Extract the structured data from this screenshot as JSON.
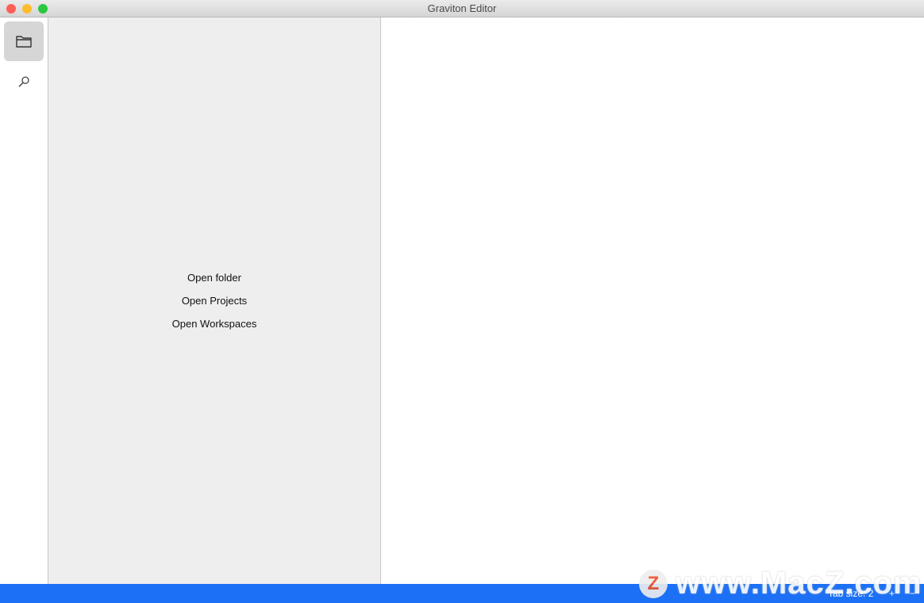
{
  "window": {
    "title": "Graviton Editor"
  },
  "activity_bar": {
    "items": [
      {
        "icon": "folder-icon",
        "active": true
      },
      {
        "icon": "search-icon",
        "active": false
      }
    ]
  },
  "sidebar": {
    "links": [
      "Open folder",
      "Open Projects",
      "Open Workspaces"
    ]
  },
  "status_bar": {
    "tab_size": "Tab size: 2",
    "increase": "+",
    "decrease": "−",
    "color": "#1b70f5"
  },
  "watermark": {
    "text": "www.MacZ.com",
    "logo_letter": "Z"
  }
}
